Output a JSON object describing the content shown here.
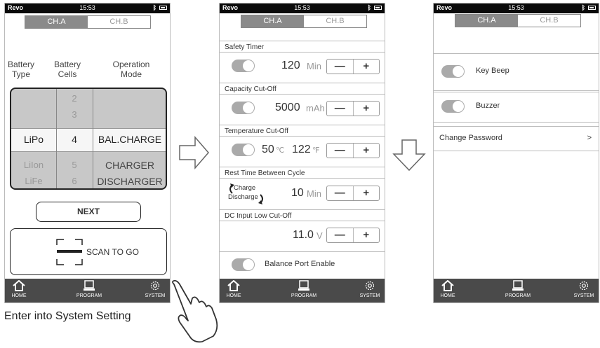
{
  "status": {
    "carrier": "Revo",
    "time": "15:53"
  },
  "tabs": {
    "ch_a": "CH.A",
    "ch_b": "CH.B"
  },
  "screen1": {
    "headers": {
      "type": "Battery\nType",
      "cells": "Battery\nCells",
      "mode": "Operation\nMode"
    },
    "picker": {
      "cells_above": [
        "2",
        "3"
      ],
      "selected": {
        "type": "LiPo",
        "cells": "4",
        "mode": "BAL.CHARGE"
      },
      "below": [
        {
          "type": "LiIon",
          "cells": "5",
          "mode": "CHARGER"
        },
        {
          "type": "LiFe",
          "cells": "6",
          "mode": "DISCHARGER"
        }
      ]
    },
    "next_label": "NEXT",
    "scan_label": "SCAN TO GO"
  },
  "screen2": {
    "safety_timer": {
      "label": "Safety Timer",
      "value": "120",
      "unit": "Min"
    },
    "capacity": {
      "label": "Capacity Cut-Off",
      "value": "5000",
      "unit": "mAh"
    },
    "temperature": {
      "label": "Temperature Cut-Off",
      "value_c": "50",
      "unit_c": "℃",
      "value_f": "122",
      "unit_f": "℉"
    },
    "rest": {
      "label": "Rest Time Between Cycle",
      "charge": "Charge",
      "discharge": "Discharge",
      "value": "10",
      "unit": "Min"
    },
    "dc_input": {
      "label": "DC Input Low Cut-Off",
      "value": "11.0",
      "unit": "V"
    },
    "balance_label": "Balance Port Enable",
    "minus": "—",
    "plus": "+"
  },
  "screen3": {
    "key_beep": "Key Beep",
    "buzzer": "Buzzer",
    "change_password": "Change Password",
    "chevron": ">"
  },
  "nav": {
    "home": "HOME",
    "program": "PROGRAM",
    "system": "SYSTEM"
  },
  "caption": "Enter into System Setting",
  "colors": {
    "toggle": "#aaaaaa",
    "navbar": "#4a4a4a",
    "picker_bg": "#c8c8c8",
    "tab_active": "#8a8a8a"
  }
}
